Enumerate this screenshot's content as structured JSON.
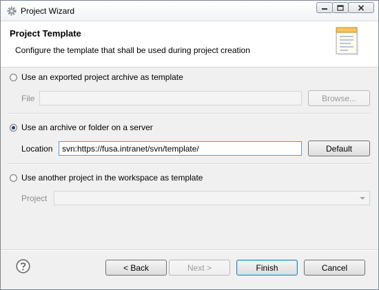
{
  "window": {
    "title": "Project Wizard"
  },
  "header": {
    "title": "Project Template",
    "description": "Configure the template that shall be used during project creation"
  },
  "option_archive": {
    "label": "Use an exported project archive as template",
    "selected": false,
    "file_label": "File",
    "file_value": "",
    "browse_label": "Browse..."
  },
  "option_server": {
    "label": "Use an archive or folder on a server",
    "selected": true,
    "location_label": "Location",
    "location_value": "svn:https://fusa.intranet/svn/template/",
    "default_label": "Default"
  },
  "option_workspace": {
    "label": "Use another project in the workspace as template",
    "selected": false,
    "project_label": "Project",
    "project_value": ""
  },
  "footer": {
    "back_label": "< Back",
    "next_label": "Next >",
    "finish_label": "Finish",
    "cancel_label": "Cancel"
  },
  "icons": {
    "window": "gear-icon",
    "help": "help-icon",
    "header": "template-document-icon"
  }
}
